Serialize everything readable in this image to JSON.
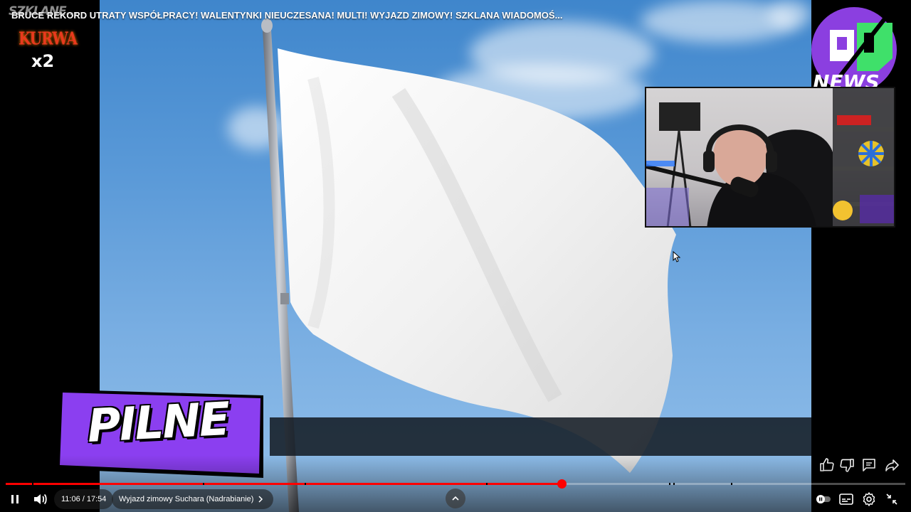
{
  "video": {
    "title": "BRUCE REKORD UTRATY WSPÓŁPRACY! WALENTYNKI NIEUCZESANA! MULTI! WYJAZD ZIMOWY! SZKLANA WIADOMOŚ...",
    "lower_third_text": "PILNE"
  },
  "logos": {
    "top_left_brand": "SZKLANE...",
    "top_left_kurwa": "KURWA",
    "top_left_multiplier": "x2",
    "top_right_text": "NEWS"
  },
  "player": {
    "time_current": "11:06",
    "time_separator": " / ",
    "time_total": "17:54",
    "chapter_label": "Wyjazd zimowy Suchara (Nadrabianie)",
    "progress_fraction": 0.6178,
    "chapter_markers": [
      0.029,
      0.219,
      0.332,
      0.534,
      0.737,
      0.742,
      0.806
    ],
    "accent_color": "#ff0000"
  },
  "icons": {
    "pause": "pause-icon",
    "volume": "volume-icon",
    "chapter_chevron": "chevron-right-icon",
    "expand": "chevron-up-icon",
    "like": "thumbs-up-icon",
    "dislike": "thumbs-down-icon",
    "comments": "comment-icon",
    "share": "share-icon",
    "autoplay": "autoplay-toggle-icon",
    "subtitles": "subtitles-icon",
    "settings": "gear-icon",
    "exit_fullscreen": "exit-fullscreen-icon"
  }
}
